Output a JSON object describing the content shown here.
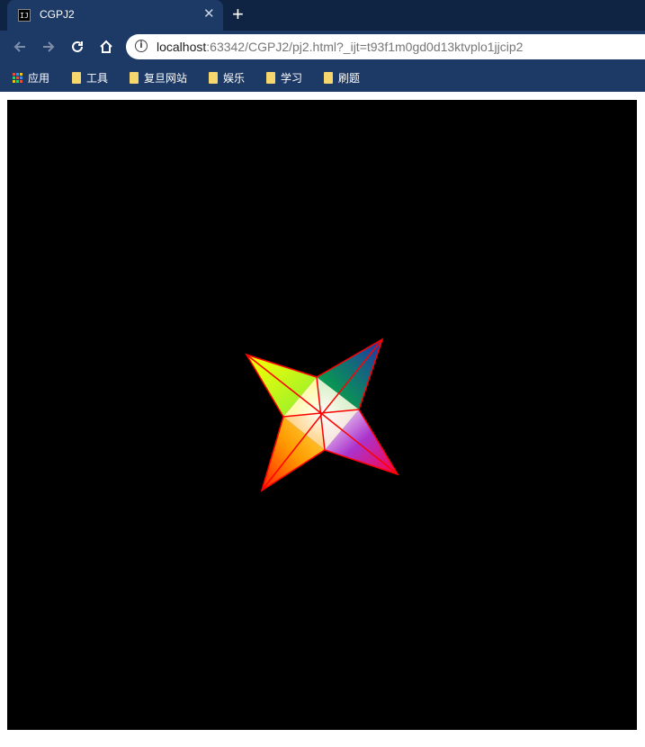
{
  "tab": {
    "title": "CGPJ2",
    "favicon_text": "IJ"
  },
  "address_bar": {
    "host": "localhost",
    "path": ":63342/CGPJ2/pj2.html?_ijt=t93f1m0gd0d13ktvplo1jjcip2"
  },
  "bookmarks": [
    {
      "label": "应用",
      "icon": "apps-icon"
    },
    {
      "label": "工具",
      "icon": "folder-icon"
    },
    {
      "label": "复旦网站",
      "icon": "folder-icon"
    },
    {
      "label": "娱乐",
      "icon": "folder-icon"
    },
    {
      "label": "学习",
      "icon": "folder-icon"
    },
    {
      "label": "刷题",
      "icon": "folder-icon"
    }
  ],
  "colors": {
    "tabbar": "#0f2343",
    "toolbar": "#1d3a66",
    "canvas": "#000000",
    "edge": "#ff0000"
  },
  "scene": {
    "description_type": "webgl-canvas",
    "shape": "four-pointed-star",
    "vertex_colors": [
      "#ffff00",
      "#00cc00",
      "#2233aa",
      "#ffffff",
      "#aa33cc",
      "#ff0044",
      "#ff0000",
      "#ffaa00"
    ]
  }
}
